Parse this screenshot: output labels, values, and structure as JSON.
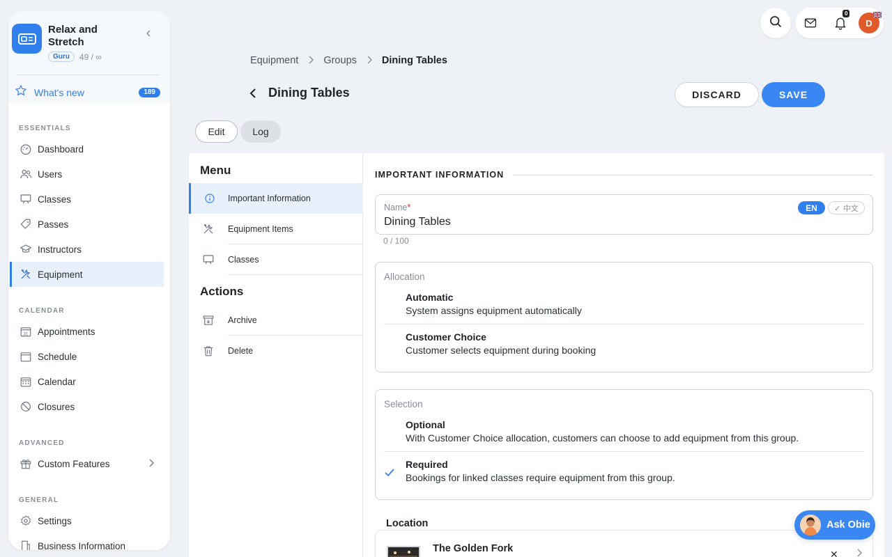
{
  "sidebar": {
    "brand_name": "Relax and Stretch",
    "tier": "Guru",
    "count": "49 / ∞",
    "whats_new": {
      "label": "What's new",
      "badge": "189"
    },
    "sections": {
      "essentials": "ESSENTIALS",
      "calendar": "CALENDAR",
      "advanced": "ADVANCED",
      "general": "GENERAL"
    },
    "items": {
      "dashboard": "Dashboard",
      "users": "Users",
      "classes": "Classes",
      "passes": "Passes",
      "instructors": "Instructors",
      "equipment": "Equipment",
      "appointments": "Appointments",
      "schedule": "Schedule",
      "calendar": "Calendar",
      "closures": "Closures",
      "custom_features": "Custom Features",
      "settings": "Settings",
      "business_information": "Business Information"
    },
    "calendar_icon_day": "31"
  },
  "topbar": {
    "notification_count": "0",
    "avatar_initial": "D"
  },
  "breadcrumb": {
    "items": [
      "Equipment",
      "Groups"
    ],
    "current": "Dining Tables"
  },
  "header": {
    "title": "Dining Tables",
    "discard_label": "DISCARD",
    "save_label": "SAVE"
  },
  "tabs": {
    "edit": "Edit",
    "log": "Log"
  },
  "menu": {
    "menu_heading": "Menu",
    "actions_heading": "Actions",
    "items": {
      "important_information": "Important Information",
      "equipment_items": "Equipment Items",
      "classes": "Classes"
    },
    "actions": {
      "archive": "Archive",
      "delete": "Delete"
    }
  },
  "form": {
    "section_title": "IMPORTANT INFORMATION",
    "name": {
      "label": "Name",
      "required_mark": "*",
      "value": "Dining Tables",
      "char_count": "0 / 100",
      "lang_en": "EN",
      "lang_zh": "✓ 中文"
    },
    "allocation": {
      "label": "Allocation",
      "options": [
        {
          "title": "Automatic",
          "desc": "System assigns equipment automatically"
        },
        {
          "title": "Customer Choice",
          "desc": "Customer selects equipment during booking"
        }
      ]
    },
    "selection": {
      "label": "Selection",
      "options": [
        {
          "title": "Optional",
          "desc": "With Customer Choice allocation, customers can choose to add equipment from this group."
        },
        {
          "title": "Required",
          "desc": "Bookings for linked classes require equipment from this group.",
          "checked": true
        }
      ]
    },
    "location": {
      "label": "Location",
      "item_name": "The Golden Fork",
      "remove_glyph": "✕"
    }
  },
  "assistant": {
    "label": "Ask Obie"
  },
  "colors": {
    "accent": "#2f80ed",
    "save_button": "#3a86f2",
    "avatar": "#e05a2b"
  }
}
